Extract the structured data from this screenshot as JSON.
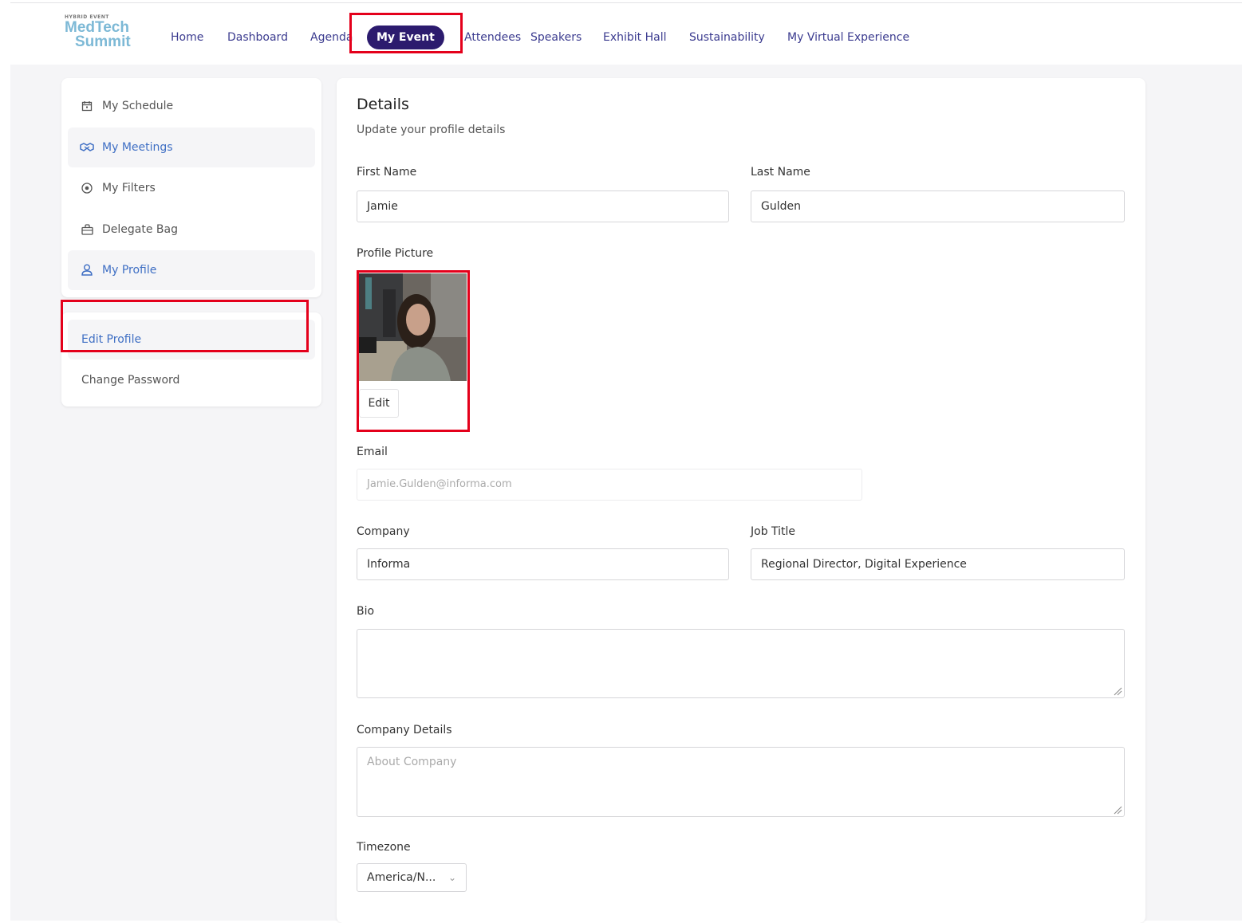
{
  "brand": {
    "small": "HYBRID EVENT",
    "line1": "MedTech",
    "line2": "Summit"
  },
  "nav": {
    "items": [
      {
        "label": "Home"
      },
      {
        "label": "Dashboard"
      },
      {
        "label": "Agenda"
      },
      {
        "label": "My Event",
        "active": true
      },
      {
        "label": "Attendees"
      },
      {
        "label": "Speakers"
      },
      {
        "label": "Exhibit Hall"
      },
      {
        "label": "Sustainability"
      },
      {
        "label": "My Virtual Experience"
      }
    ]
  },
  "sidebar": {
    "items": [
      {
        "label": "My Schedule",
        "icon": "calendar-icon"
      },
      {
        "label": "My Meetings",
        "icon": "handshake-icon",
        "highlight": true
      },
      {
        "label": "My Filters",
        "icon": "target-icon"
      },
      {
        "label": "Delegate Bag",
        "icon": "bag-icon"
      },
      {
        "label": "My Profile",
        "icon": "user-icon",
        "highlight": true
      }
    ],
    "sub_items": [
      {
        "label": "Edit Profile",
        "active": true
      },
      {
        "label": "Change Password"
      }
    ]
  },
  "details": {
    "title": "Details",
    "subtitle": "Update your profile details",
    "first_name_label": "First Name",
    "first_name": "Jamie",
    "last_name_label": "Last Name",
    "last_name": "Gulden",
    "picture_label": "Profile Picture",
    "edit_label": "Edit",
    "email_label": "Email",
    "email": "Jamie.Gulden@informa.com",
    "company_label": "Company",
    "company": "Informa",
    "job_title_label": "Job Title",
    "job_title": "Regional Director, Digital Experience",
    "bio_label": "Bio",
    "bio": "",
    "company_details_label": "Company Details",
    "company_details_placeholder": "About Company",
    "timezone_label": "Timezone",
    "timezone": "America/N..."
  },
  "colors": {
    "accent": "#2c1b6e",
    "link": "#3f6fc4",
    "highlight_box": "#e4001b"
  }
}
